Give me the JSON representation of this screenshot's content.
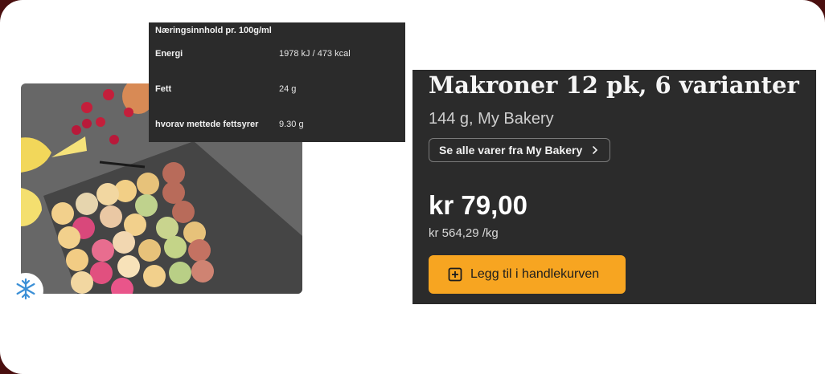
{
  "nutrition": {
    "title": "Næringsinnhold pr. 100g/ml",
    "rows": [
      {
        "label": "Energi",
        "value": "1978 kJ / 473 kcal"
      },
      {
        "label": "Fett",
        "value": "24 g"
      },
      {
        "label": "hvorav mettede fettsyrer",
        "value": "9.30 g"
      }
    ]
  },
  "product": {
    "title": "Makroner 12 pk, 6 varianter",
    "subtitle": "144 g, My Bakery",
    "brand_link": "Se alle varer fra My Bakery",
    "price": "kr 79,00",
    "unit_price": "kr 564,29 /kg",
    "add_to_cart": "Legg til i handlekurven"
  },
  "icons": {
    "frozen": "snowflake-icon",
    "chevron": "chevron-right-icon",
    "add": "plus-square-icon"
  },
  "colors": {
    "panel_bg": "#2b2b2b",
    "button_accent": "#f7a521",
    "frozen_icon": "#3b8fd6"
  }
}
